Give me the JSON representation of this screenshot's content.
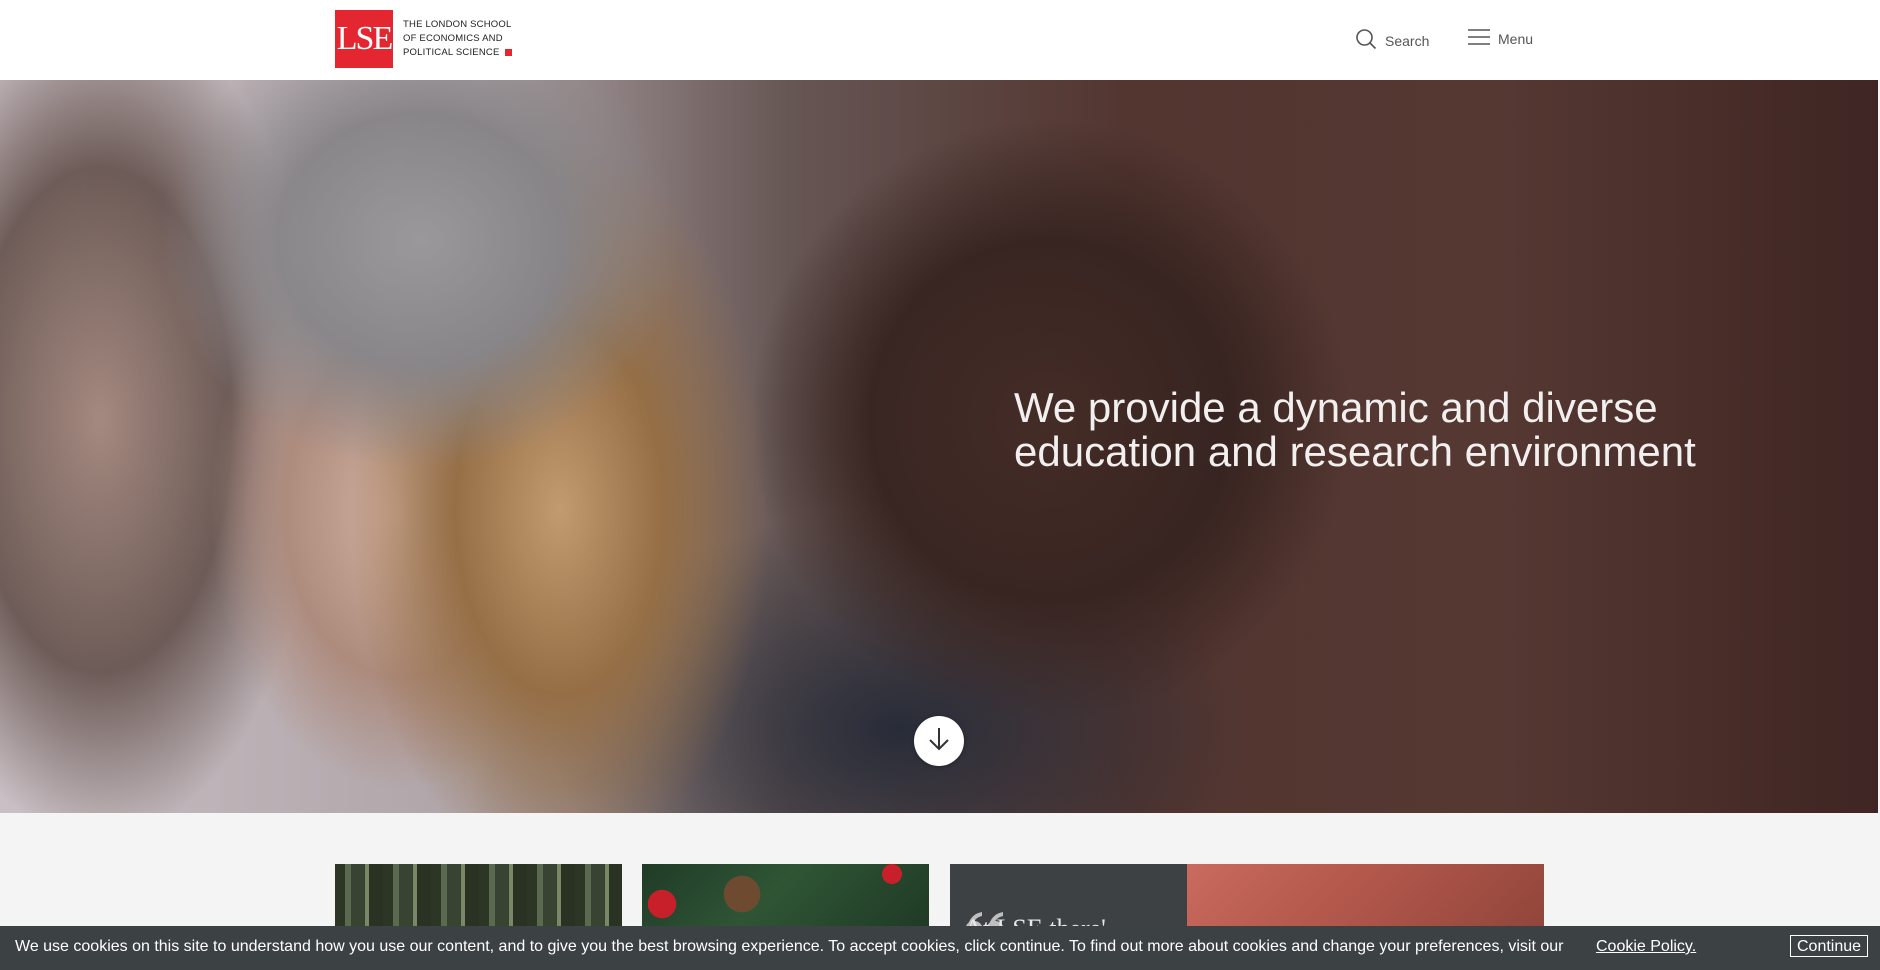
{
  "header": {
    "logo_mark": "LSE",
    "logo_lines": [
      "The London School",
      "of Economics and",
      "Political Science"
    ],
    "search_label": "Search",
    "menu_label": "Menu"
  },
  "hero": {
    "headline": "We provide a dynamic and diverse education and research environment",
    "scroll_icon": "arrow-down-icon"
  },
  "cards": {
    "quote_mark": "66",
    "quote_text": "At LSE there'"
  },
  "cookie_bar": {
    "message": "We use cookies on this site to understand how you use our content, and to give you the best browsing experience. To accept cookies, click continue. To find out more about cookies and change your preferences, visit our",
    "link_label": "Cookie Policy.",
    "button_label": "Continue"
  },
  "colors": {
    "brand_red": "#e3262f",
    "cookie_bg": "#3c4144"
  }
}
